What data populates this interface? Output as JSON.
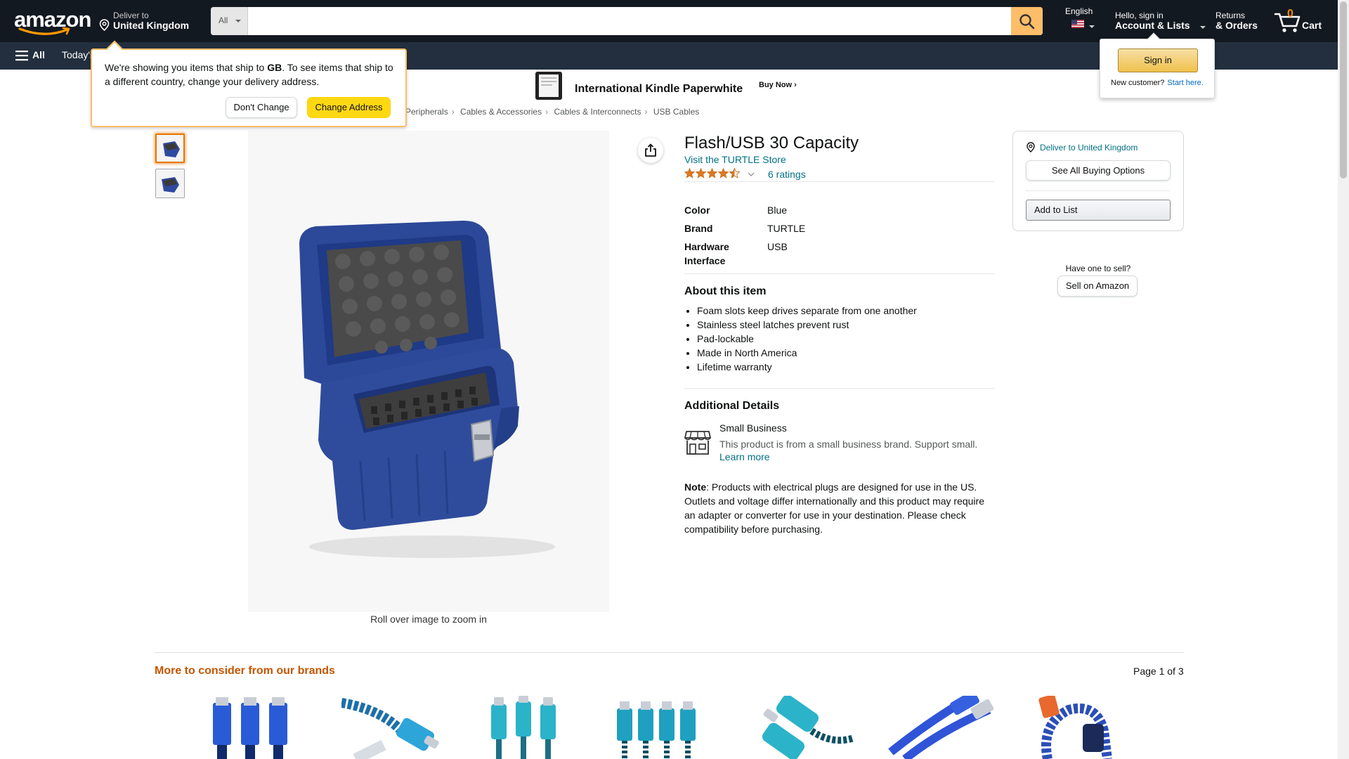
{
  "nav": {
    "logo": "amazon",
    "deliver_line1": "Deliver to",
    "deliver_line2": "United Kingdom",
    "search_category": "All",
    "search_placeholder": "",
    "language": "English",
    "account_line1": "Hello, sign in",
    "account_line2": "Account & Lists",
    "returns_line1": "Returns",
    "returns_line2": "& Orders",
    "cart_count": "0",
    "cart_label": "Cart",
    "accent_color": "#febd69"
  },
  "subnav": {
    "all_label": "All",
    "deals_label": "Today's"
  },
  "popover": {
    "message_pre": "We're showing you items that ship to ",
    "country_code": "GB",
    "message_post": ". To see items that ship to a different country, change your delivery address.",
    "dont_change": "Don't Change",
    "change_address": "Change Address"
  },
  "signin": {
    "button": "Sign in",
    "new_customer": "New customer?",
    "start_here": "Start here."
  },
  "banner": {
    "title": "International Kindle Paperwhite",
    "cta": "Buy Now ›"
  },
  "breadcrumbs": [
    "Peripherals",
    "Cables & Accessories",
    "Cables & Interconnects",
    "USB Cables"
  ],
  "product": {
    "title": "Flash/USB 30 Capacity",
    "store_link": "Visit the TURTLE Store",
    "rating": 4.5,
    "ratings_count": "6 ratings",
    "zoom_hint": "Roll over image to zoom in",
    "specs": [
      {
        "label": "Color",
        "value": "Blue"
      },
      {
        "label": "Brand",
        "value": "TURTLE"
      },
      {
        "label": "Hardware Interface",
        "value": "USB"
      }
    ],
    "about_heading": "About this item",
    "bullets": [
      "Foam slots keep drives separate from one another",
      "Stainless steel latches prevent rust",
      "Pad-lockable",
      "Made in North America",
      "Lifetime warranty"
    ],
    "additional_heading": "Additional Details",
    "small_business_title": "Small Business",
    "small_business_desc": "This product is from a small business brand. Support small.",
    "learn_more": "Learn more",
    "note_label": "Note",
    "note_text": ": Products with electrical plugs are designed for use in the US. Outlets and voltage differ internationally and this product may require an adapter or converter for use in your destination. Please check compatibility before purchasing."
  },
  "buybox": {
    "deliver_to": "Deliver to United Kingdom",
    "see_options": "See All Buying Options",
    "add_to_list": "Add to List",
    "have_one": "Have one to sell?",
    "sell_on": "Sell on Amazon"
  },
  "brands": {
    "title": "More to consider from our brands",
    "page": "Page 1 of 3"
  }
}
